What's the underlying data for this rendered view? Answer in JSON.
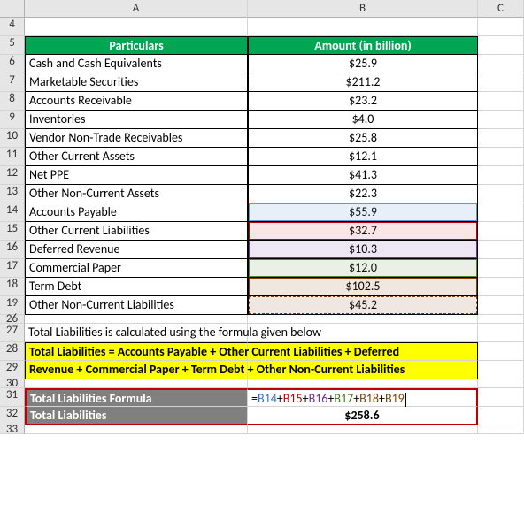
{
  "cols": {
    "A": "A",
    "B": "B",
    "C": "C"
  },
  "rownums": [
    "4",
    "5",
    "6",
    "7",
    "8",
    "9",
    "10",
    "11",
    "12",
    "13",
    "14",
    "15",
    "16",
    "17",
    "18",
    "19",
    "26",
    "27",
    "28",
    "29",
    "30",
    "31",
    "32",
    "33"
  ],
  "header": {
    "particulars": "Particulars",
    "amount": "Amount (in billion)"
  },
  "rows": [
    {
      "label": "Cash and Cash Equivalents",
      "amount": "$25.9"
    },
    {
      "label": "Marketable Securities",
      "amount": "$211.2"
    },
    {
      "label": "Accounts Receivable",
      "amount": "$23.2"
    },
    {
      "label": "Inventories",
      "amount": "$4.0"
    },
    {
      "label": "Vendor Non-Trade Receivables",
      "amount": "$25.8"
    },
    {
      "label": "Other Current Assets",
      "amount": "$12.1"
    },
    {
      "label": "Net PPE",
      "amount": "$41.3"
    },
    {
      "label": "Other Non-Current Assets",
      "amount": "$22.3"
    },
    {
      "label": "Accounts Payable",
      "amount": "$55.9"
    },
    {
      "label": "Other Current Liabilities",
      "amount": "$32.7"
    },
    {
      "label": "Deferred Revenue",
      "amount": "$10.3"
    },
    {
      "label": "Commercial Paper",
      "amount": "$12.0"
    },
    {
      "label": "Term Debt",
      "amount": "$102.5"
    },
    {
      "label": "Other Non-Current Liabilities",
      "amount": "$45.2"
    }
  ],
  "note": "Total Liabilities is calculated using the formula given below",
  "formula_text_1": "Total Liabilities = Accounts Payable + Other Current Liabilities + Deferred ",
  "formula_text_2": "Revenue + Commercial Paper + Term Debt + Other Non-Current Liabilities",
  "result_label": "Total Liabilities Formula",
  "result_label2": "Total Liabilities",
  "result_value": "$258.6",
  "formula_bar": {
    "eq": "=",
    "r1": "B14",
    "p1": "+",
    "r2": "B15",
    "p2": "+",
    "r3": "B16",
    "p3": "+",
    "r4": "B17",
    "p4": "+",
    "r5": "B18",
    "p5": "+",
    "r6": "B19"
  }
}
